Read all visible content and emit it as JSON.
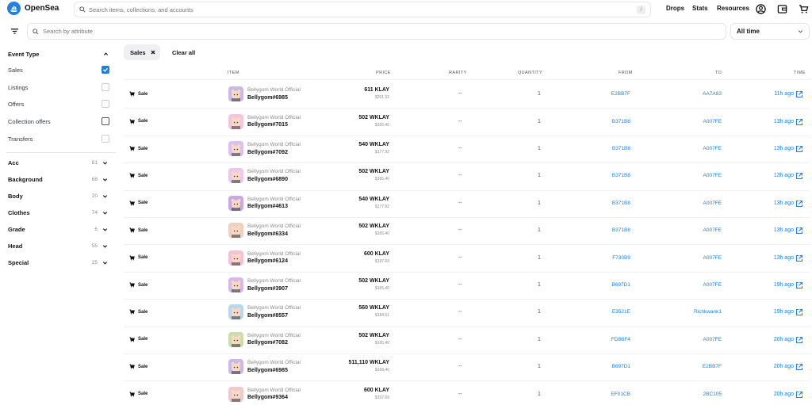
{
  "header": {
    "logo_text": "OpenSea",
    "search_placeholder": "Search items, collections, and accounts",
    "search_shortcut": "/",
    "nav": [
      "Drops",
      "Stats",
      "Resources"
    ]
  },
  "filter_bar": {
    "search_placeholder": "Search by attribute",
    "time_filter": "All time"
  },
  "sidebar": {
    "event_type_heading": "Event Type",
    "event_types": [
      {
        "label": "Sales",
        "checked": true
      },
      {
        "label": "Listings",
        "checked": false
      },
      {
        "label": "Offers",
        "checked": false
      },
      {
        "label": "Collection offers",
        "checked": false
      },
      {
        "label": "Transfers",
        "checked": false
      }
    ],
    "traits": [
      {
        "label": "Acc",
        "count": "81"
      },
      {
        "label": "Background",
        "count": "68"
      },
      {
        "label": "Body",
        "count": "20"
      },
      {
        "label": "Clothes",
        "count": "74"
      },
      {
        "label": "Grade",
        "count": "6"
      },
      {
        "label": "Head",
        "count": "55"
      },
      {
        "label": "Special",
        "count": "25"
      }
    ]
  },
  "active_filters": {
    "chip": "Sales",
    "clear_all": "Clear all"
  },
  "table": {
    "headers": {
      "item": "ITEM",
      "price": "PRICE",
      "rarity": "RARITY",
      "quantity": "QUANTITY",
      "from": "FROM",
      "to": "TO",
      "time": "TIME"
    },
    "rows": [
      {
        "event": "Sale",
        "collection": "Bellygom World Official",
        "item": "Bellygom#6985",
        "price": "611 KLAY",
        "usd": "$201.32",
        "rarity": "--",
        "quantity": "1",
        "from": "E2BB7F",
        "to": "AA7A83",
        "time": "11h ago",
        "thumb": "#c9b8e8"
      },
      {
        "event": "Sale",
        "collection": "Bellygom World Official",
        "item": "Bellygom#7015",
        "price": "502 WKLAY",
        "usd": "$165.40",
        "rarity": "--",
        "quantity": "1",
        "from": "B371B8",
        "to": "A007FE",
        "time": "13h ago",
        "thumb": "#f5c5dc"
      },
      {
        "event": "Sale",
        "collection": "Bellygom World Official",
        "item": "Bellygom#7092",
        "price": "540 WKLAY",
        "usd": "$177.92",
        "rarity": "--",
        "quantity": "1",
        "from": "B371B8",
        "to": "A007FE",
        "time": "13h ago",
        "thumb": "#d9c0f0"
      },
      {
        "event": "Sale",
        "collection": "Bellygom World Official",
        "item": "Bellygom#6890",
        "price": "502 WKLAY",
        "usd": "$165.40",
        "rarity": "--",
        "quantity": "1",
        "from": "B371B8",
        "to": "A007FE",
        "time": "13h ago",
        "thumb": "#e8c8f0"
      },
      {
        "event": "Sale",
        "collection": "Bellygom World Official",
        "item": "Bellygom#4613",
        "price": "540 WKLAY",
        "usd": "$177.92",
        "rarity": "--",
        "quantity": "1",
        "from": "B371B8",
        "to": "A007FE",
        "time": "13h ago",
        "thumb": "#c8a8e8"
      },
      {
        "event": "Sale",
        "collection": "Bellygom World Official",
        "item": "Bellygom#6334",
        "price": "502 WKLAY",
        "usd": "$165.40",
        "rarity": "--",
        "quantity": "1",
        "from": "B371B8",
        "to": "A007FE",
        "time": "13h ago",
        "thumb": "#f0d0c0"
      },
      {
        "event": "Sale",
        "collection": "Bellygom World Official",
        "item": "Bellygom#6124",
        "price": "600 KLAY",
        "usd": "$197.69",
        "rarity": "--",
        "quantity": "1",
        "from": "F730B9",
        "to": "A007FE",
        "time": "13h ago",
        "thumb": "#f5c0d8"
      },
      {
        "event": "Sale",
        "collection": "Bellygom World Official",
        "item": "Bellygom#3907",
        "price": "502 WKLAY",
        "usd": "$165.40",
        "rarity": "--",
        "quantity": "1",
        "from": "B697D1",
        "to": "A007FE",
        "time": "19h ago",
        "thumb": "#d8b8e8"
      },
      {
        "event": "Sale",
        "collection": "Bellygom World Official",
        "item": "Bellygom#8557",
        "price": "560 WKLAY",
        "usd": "$184.51",
        "rarity": "--",
        "quantity": "1",
        "from": "E3521E",
        "to": "Richkwank1",
        "time": "19h ago",
        "thumb": "#b8d8f0"
      },
      {
        "event": "Sale",
        "collection": "Bellygom World Official",
        "item": "Bellygom#7082",
        "price": "502 WKLAY",
        "usd": "$165.40",
        "rarity": "--",
        "quantity": "1",
        "from": "FD8BF4",
        "to": "A007FE",
        "time": "20h ago",
        "thumb": "#c8e0a8"
      },
      {
        "event": "Sale",
        "collection": "Bellygom World Official",
        "item": "Bellygom#6985",
        "price": "511,110 WKLAY",
        "usd": "$168.40",
        "rarity": "--",
        "quantity": "1",
        "from": "B697D1",
        "to": "E2BB7F",
        "time": "20h ago",
        "thumb": "#c9b8e8"
      },
      {
        "event": "Sale",
        "collection": "Bellygom World Official",
        "item": "Bellygom#9364",
        "price": "600 KLAY",
        "usd": "$197.69",
        "rarity": "--",
        "quantity": "1",
        "from": "EF01CB",
        "to": "2BC105",
        "time": "20h ago",
        "thumb": "#f0c8d0"
      }
    ]
  },
  "colors": {
    "accent": "#2081e2",
    "text": "#121212",
    "muted": "#8a8a8a"
  }
}
